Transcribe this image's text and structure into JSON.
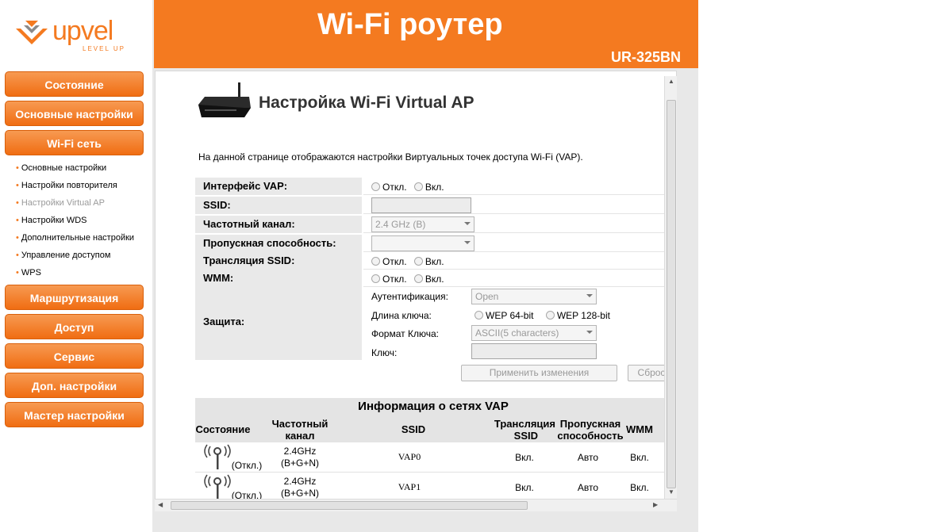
{
  "header": {
    "logo_text": "upvel",
    "logo_sub": "LEVEL UP",
    "title": "Wi-Fi роутер",
    "model": "UR-325BN"
  },
  "colors": {
    "brand": "#f47a20",
    "button": "#f06d12"
  },
  "sidebar": {
    "menu": [
      {
        "label": "Состояние"
      },
      {
        "label": "Основные настройки"
      },
      {
        "label": "Wi-Fi сеть"
      },
      {
        "label": "Маршрутизация"
      },
      {
        "label": "Доступ"
      },
      {
        "label": "Сервис"
      },
      {
        "label": "Доп. настройки"
      },
      {
        "label": "Мастер настройки"
      }
    ],
    "submenu": [
      {
        "label": "Основные настройки"
      },
      {
        "label": "Настройки повторителя"
      },
      {
        "label": "Настройки Virtual AP",
        "active": true
      },
      {
        "label": "Настройки WDS"
      },
      {
        "label": "Дополнительные настройки"
      },
      {
        "label": "Управление доступом"
      },
      {
        "label": "WPS"
      }
    ]
  },
  "page": {
    "title": "Настройка Wi-Fi Virtual AP",
    "description": "На данной странице отображаются настройки Виртуальных точек доступа Wi-Fi (VAP).",
    "radio_off": "Откл.",
    "radio_on": "Вкл.",
    "fields": {
      "vap_interface": "Интерфейс VAP:",
      "ssid": "SSID:",
      "channel": "Частотный канал:",
      "channel_value": "2.4 GHz (B)",
      "bandwidth": "Пропускная способность:",
      "ssid_broadcast": "Трансляция SSID:",
      "wmm": "WMM:",
      "security": "Защита:"
    },
    "security": {
      "auth_label": "Аутентификация:",
      "auth_value": "Open",
      "key_length_label": "Длина ключа:",
      "wep64": "WEP 64-bit",
      "wep128": "WEP 128-bit",
      "key_format_label": "Формат Ключа:",
      "key_format_value": "ASCII(5 characters)",
      "key_label": "Ключ:"
    },
    "buttons": {
      "apply": "Применить изменения",
      "reset": "Сброс"
    }
  },
  "vap_info": {
    "title": "Информация о сетях VAP",
    "columns": {
      "status": "Состояние",
      "channel_l1": "Частотный",
      "channel_l2": "канал",
      "ssid": "SSID",
      "broadcast_l1": "Трансляция",
      "broadcast_l2": "SSID",
      "bandwidth_l1": "Пропускная",
      "bandwidth_l2": "способность",
      "wmm": "WMM"
    },
    "rows": [
      {
        "status": "(Откл.)",
        "channel_l1": "2.4GHz",
        "channel_l2": "(B+G+N)",
        "ssid": "VAP0",
        "broadcast": "Вкл.",
        "bandwidth": "Авто",
        "wmm": "Вкл."
      },
      {
        "status": "(Откл.)",
        "channel_l1": "2.4GHz",
        "channel_l2": "(B+G+N)",
        "ssid": "VAP1",
        "broadcast": "Вкл.",
        "bandwidth": "Авто",
        "wmm": "Вкл."
      }
    ]
  }
}
